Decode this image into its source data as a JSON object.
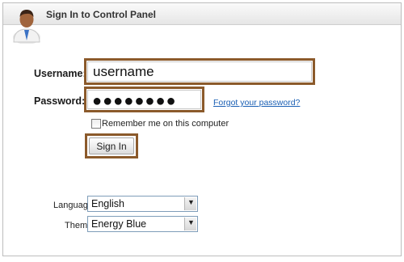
{
  "header": {
    "title": "Sign In to Control Panel"
  },
  "form": {
    "username_label": "Username:",
    "username_value": "username",
    "password_label": "Password:",
    "password_masked": "●●●●●●●●",
    "forgot_link": "Forgot your password?",
    "remember_label": "Remember me on this computer",
    "remember_checked": false,
    "signin_label": "Sign In"
  },
  "settings": {
    "language_label": "Language:",
    "language_value": "English",
    "theme_label": "Theme:",
    "theme_value": "Energy Blue"
  },
  "colors": {
    "highlight_border": "#8b5a2b",
    "link": "#1a5fb4"
  }
}
